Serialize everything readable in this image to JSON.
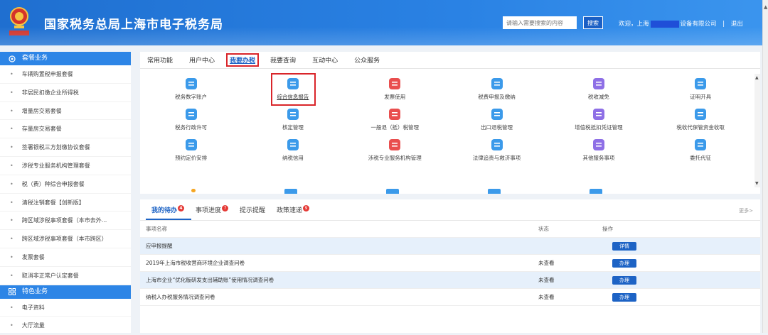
{
  "header": {
    "title": "国家税务总局上海市电子税务局",
    "search_placeholder": "请输入需要搜索的内容",
    "search_label": "搜索",
    "welcome_prefix": "欢迎，上海",
    "company_suffix": "设备有限公司",
    "separator": "|",
    "logout_label": "退出",
    "brand_color": "#2a82e4"
  },
  "sidebar": {
    "section1": "套餐业务",
    "items1": [
      "车辆购置税申报套餐",
      "非居民扣缴企业所得税",
      "增量房交易套餐",
      "存量房交易套餐",
      "签署银税三方划缴协议套餐",
      "涉税专业服务机构管理套餐",
      "税（费）种综合申报套餐",
      "清税注销套餐【创新版】",
      "跨区域涉税事项套餐（本市去外...",
      "跨区域涉税事项套餐（本市跨区）",
      "发票套餐",
      "取消非正常户认定套餐"
    ],
    "section2": "特色业务",
    "items2": [
      "电子资料",
      "大厅流量"
    ]
  },
  "top_tabs": [
    "常用功能",
    "用户中心",
    "我要办税",
    "我要查询",
    "互动中心",
    "公众服务"
  ],
  "active_top_tab": 2,
  "services": [
    {
      "label": "税务数字账户",
      "icon": "account-icon"
    },
    {
      "label": "综合信息报告",
      "icon": "report-icon"
    },
    {
      "label": "发票使用",
      "icon": "invoice-icon"
    },
    {
      "label": "税费申报及缴纳",
      "icon": "declare-icon"
    },
    {
      "label": "税收减免",
      "icon": "reduction-icon"
    },
    {
      "label": "证明开具",
      "icon": "certificate-icon"
    },
    {
      "label": "税务行政许可",
      "icon": "permit-icon"
    },
    {
      "label": "核定管理",
      "icon": "verify-icon"
    },
    {
      "label": "一般退（抵）税管理",
      "icon": "refund-icon"
    },
    {
      "label": "出口退税管理",
      "icon": "export-refund-icon"
    },
    {
      "label": "增值税抵扣凭证管理",
      "icon": "vat-deduct-icon"
    },
    {
      "label": "税收代保管资金收取",
      "icon": "custody-icon"
    },
    {
      "label": "预约定价安排",
      "icon": "pricing-icon"
    },
    {
      "label": "纳税信用",
      "icon": "credit-icon"
    },
    {
      "label": "涉税专业服务机构管理",
      "icon": "agency-icon"
    },
    {
      "label": "法律追责与救济事项",
      "icon": "legal-icon"
    },
    {
      "label": "其他服务事项",
      "icon": "other-service-icon"
    },
    {
      "label": "委托代征",
      "icon": "entrust-icon"
    }
  ],
  "bottom": {
    "tabs": [
      {
        "label": "我的待办",
        "badge": "4"
      },
      {
        "label": "事项进度",
        "badge": "7"
      },
      {
        "label": "提示提醒",
        "badge": ""
      },
      {
        "label": "政策速递",
        "badge": "9"
      }
    ],
    "more_label": "更多>",
    "columns": [
      "事项名称",
      "状态",
      "操作"
    ],
    "rows": [
      {
        "name": "应申报提醒",
        "status": "",
        "action": "详情"
      },
      {
        "name": "2019年上海市税收营商环境企业调查问卷",
        "status": "未查看",
        "action": "办理"
      },
      {
        "name": "上海市企业“优化版研发支出辅助账”使用情况调查问卷",
        "status": "未查看",
        "action": "办理"
      },
      {
        "name": "纳税人办税服务情况调查问卷",
        "status": "未查看",
        "action": "办理"
      }
    ]
  }
}
